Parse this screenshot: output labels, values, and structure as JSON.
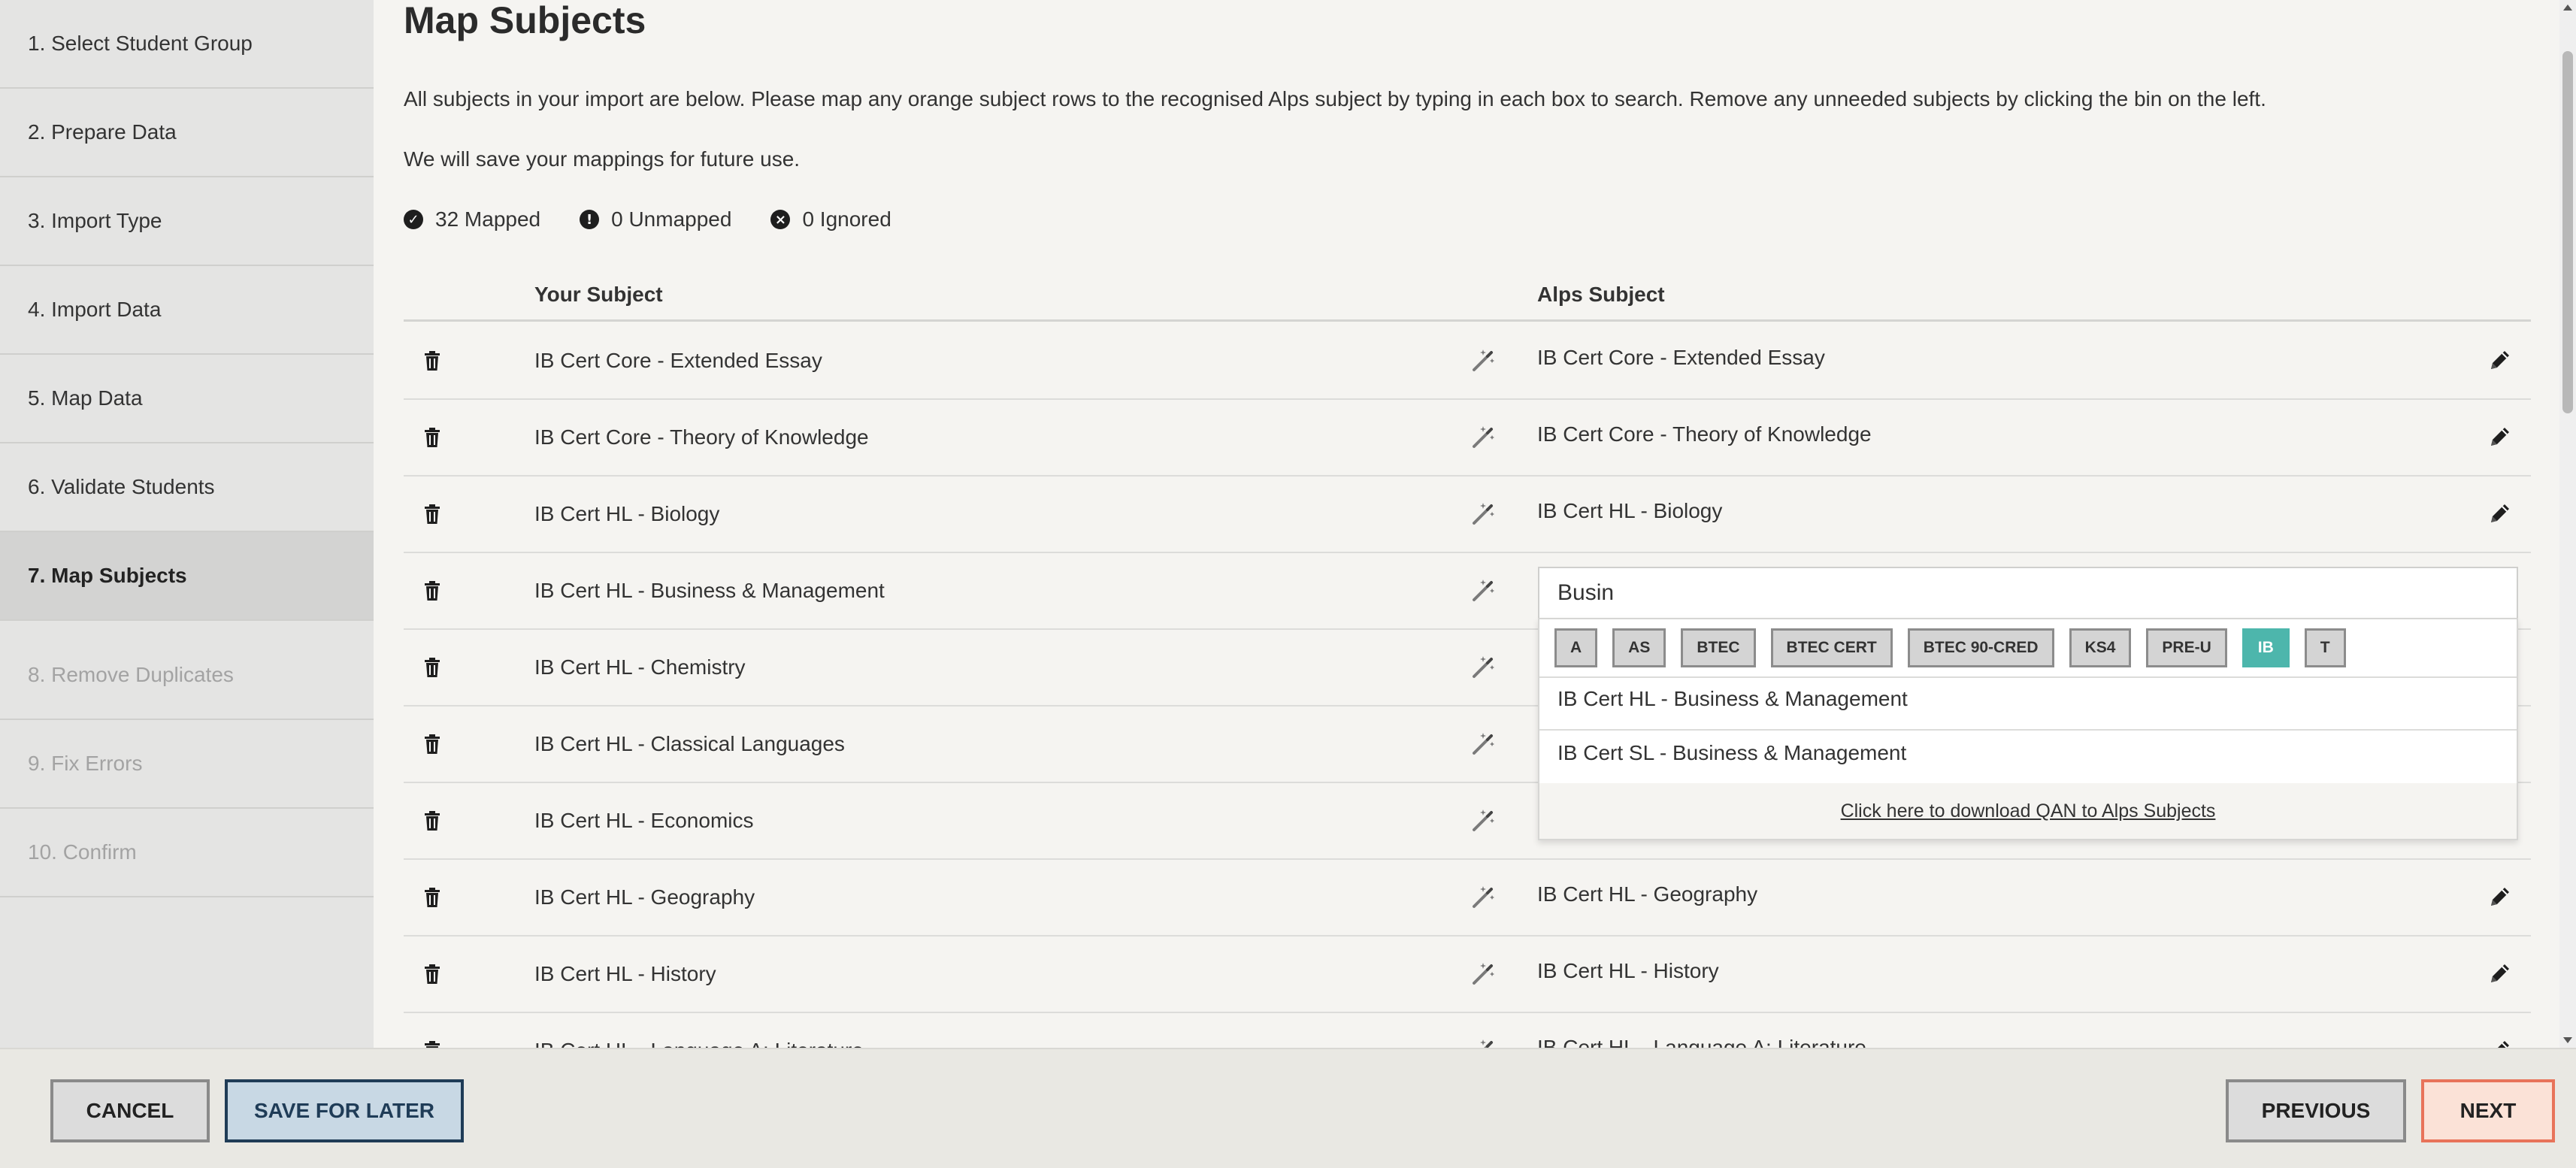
{
  "sidebar": {
    "steps": [
      {
        "label": "1. Select Student Group",
        "state": "done"
      },
      {
        "label": "2. Prepare Data",
        "state": "done"
      },
      {
        "label": "3. Import Type",
        "state": "done"
      },
      {
        "label": "4. Import Data",
        "state": "done"
      },
      {
        "label": "5. Map Data",
        "state": "done"
      },
      {
        "label": "6. Validate Students",
        "state": "done"
      },
      {
        "label": "7. Map Subjects",
        "state": "active"
      },
      {
        "label": "8. Remove Duplicates",
        "state": "disabled"
      },
      {
        "label": "9. Fix Errors",
        "state": "disabled"
      },
      {
        "label": "10. Confirm",
        "state": "disabled"
      }
    ]
  },
  "page": {
    "title": "Map Subjects",
    "intro1": "All subjects in your import are below. Please map any orange subject rows to the recognised Alps subject by typing in each box to search. Remove any unneeded subjects by clicking the bin on the left.",
    "intro2": "We will save your mappings for future use."
  },
  "stats": {
    "mapped": "32 Mapped",
    "unmapped": "0 Unmapped",
    "ignored": "0 Ignored"
  },
  "table": {
    "col_your": "Your Subject",
    "col_alps": "Alps Subject",
    "rows": [
      {
        "your": "IB Cert Core - Extended Essay",
        "alps": "IB Cert Core - Extended Essay"
      },
      {
        "your": "IB Cert Core - Theory of Knowledge",
        "alps": "IB Cert Core - Theory of Knowledge"
      },
      {
        "your": "IB Cert HL - Biology",
        "alps": "IB Cert HL - Biology"
      },
      {
        "your": "IB Cert HL - Business & Management",
        "alps": ""
      },
      {
        "your": "IB Cert HL - Chemistry",
        "alps": ""
      },
      {
        "your": "IB Cert HL - Classical Languages",
        "alps": ""
      },
      {
        "your": "IB Cert HL - Economics",
        "alps": ""
      },
      {
        "your": "IB Cert HL - Geography",
        "alps": "IB Cert HL - Geography"
      },
      {
        "your": "IB Cert HL - History",
        "alps": "IB Cert HL - History"
      },
      {
        "your": "IB Cert HL - Language A: Literature",
        "alps": "IB Cert HL - Language A: Literature"
      }
    ]
  },
  "search": {
    "value": "Busin",
    "filters": [
      "A",
      "AS",
      "BTEC",
      "BTEC CERT",
      "BTEC 90-CRED",
      "KS4",
      "PRE-U",
      "IB",
      "T"
    ],
    "active_filter": "IB",
    "results": [
      "IB Cert HL - Business & Management",
      "IB Cert SL - Business & Management"
    ],
    "footer_link": "Click here to download QAN to Alps Subjects"
  },
  "footer": {
    "cancel": "CANCEL",
    "save": "SAVE FOR LATER",
    "previous": "PREVIOUS",
    "next": "NEXT"
  },
  "colors": {
    "accent_teal": "#4db6ac",
    "next_border": "#e8735a",
    "next_bg": "#fbe2d7",
    "save_border": "#1f3c57",
    "save_bg": "#c8d8e4"
  }
}
